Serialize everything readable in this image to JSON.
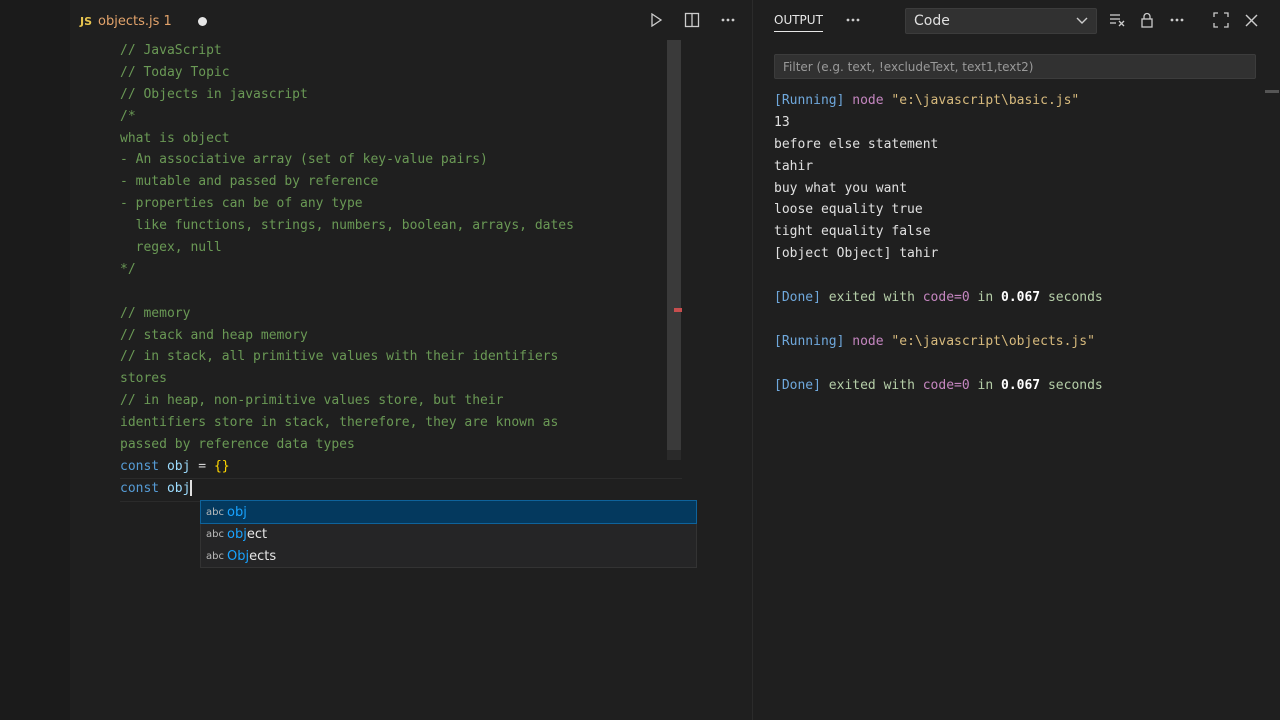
{
  "editor": {
    "tab": {
      "badge": "JS",
      "filename": "objects.js",
      "problems": "1"
    },
    "code_lines": [
      "// JavaScript",
      "// Today Topic",
      "// Objects in javascript",
      "/*",
      "what is object",
      "- An associative array (set of key-value pairs)",
      "- mutable and passed by reference",
      "- properties can be of any type",
      "  like functions, strings, numbers, boolean, arrays, dates",
      "  regex, null",
      "*/",
      "",
      "// memory",
      "// stack and heap memory",
      "// in stack, all primitive values with their identifiers",
      "stores",
      "// in heap, non-primitive values store, but their",
      "identifiers store in stack, therefore, they are known as",
      "passed by reference data types"
    ],
    "line_const1": {
      "kw": "const",
      "var": "obj",
      "op": "=",
      "value": "{}"
    },
    "line_const2": {
      "kw": "const",
      "var": "obj"
    },
    "suggestions": [
      {
        "kind": "abc",
        "match": "obj",
        "rest": ""
      },
      {
        "kind": "abc",
        "match": "obj",
        "rest": "ect"
      },
      {
        "kind": "abc",
        "match": "Obj",
        "rest": "ects"
      }
    ],
    "selected_suggestion": 0
  },
  "panel": {
    "title": "OUTPUT",
    "channel": "Code",
    "filter_placeholder": "Filter (e.g. text, !excludeText, text1,text2)",
    "run1": {
      "running_tag": "[Running]",
      "cmd": "node",
      "path": "\"e:\\javascript\\basic.js\"",
      "lines": [
        "13",
        "before else statement",
        "tahir",
        "buy what you want",
        "loose equality true",
        "tight equality false",
        "[object Object] tahir"
      ],
      "done_tag": "[Done]",
      "done_text": "exited with",
      "code": "code=0",
      "in": "in",
      "seconds": "0.067",
      "unit": "seconds"
    },
    "run2": {
      "running_tag": "[Running]",
      "cmd": "node",
      "path": "\"e:\\javascript\\objects.js\"",
      "done_tag": "[Done]",
      "done_text": "exited with",
      "code": "code=0",
      "in": "in",
      "seconds": "0.067",
      "unit": "seconds"
    }
  },
  "icons": {
    "run": "play-icon",
    "split": "split-editor-icon",
    "more": "more-actions-icon",
    "clear": "clear-output-icon",
    "lock": "lock-icon",
    "maximize": "maximize-icon",
    "close": "close-icon"
  }
}
